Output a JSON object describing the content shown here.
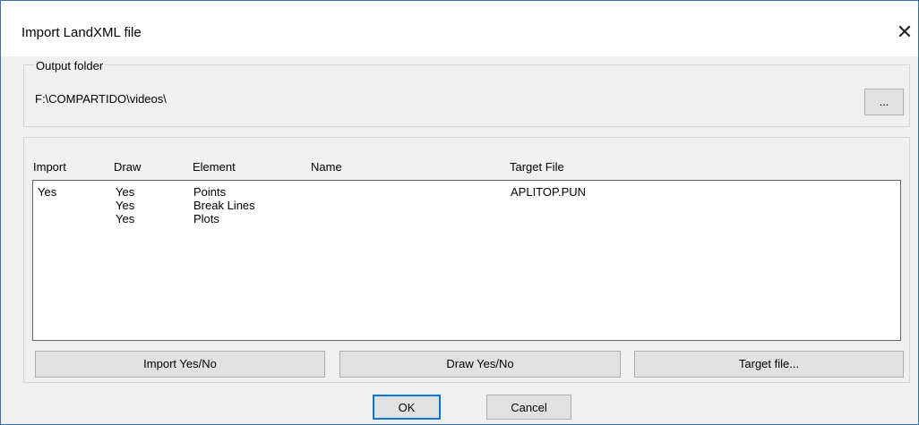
{
  "window": {
    "title": "Import LandXML file",
    "close_glyph": "✕"
  },
  "output": {
    "label": "Output folder",
    "path": "F:\\COMPARTIDO\\videos\\",
    "browse_label": "..."
  },
  "table": {
    "columns": [
      "Import",
      "Draw",
      "Element",
      "Name",
      "Target File"
    ],
    "rows": [
      {
        "import": "Yes",
        "draw": "Yes",
        "element": "Points",
        "name": "",
        "target": "APLITOP.PUN"
      },
      {
        "import": "",
        "draw": "Yes",
        "element": "Break Lines",
        "name": "",
        "target": ""
      },
      {
        "import": "",
        "draw": "Yes",
        "element": "Plots",
        "name": "",
        "target": ""
      }
    ]
  },
  "actions": {
    "import_toggle": "Import Yes/No",
    "draw_toggle": "Draw Yes/No",
    "target_file": "Target file..."
  },
  "footer": {
    "ok": "OK",
    "cancel": "Cancel"
  },
  "icons": {
    "close": "close-icon"
  }
}
